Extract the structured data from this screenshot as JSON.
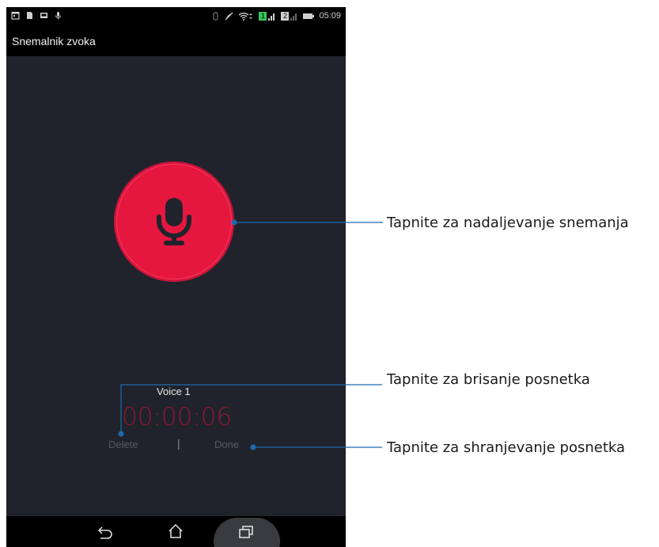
{
  "status_bar": {
    "time": "05:09",
    "sim1": "1",
    "sim2": "2",
    "left_icons": [
      "calendar-icon",
      "document-icon",
      "message-icon",
      "microphone-small-icon"
    ],
    "right_icons": [
      "bluetooth-icon",
      "mute-icon",
      "wifi-icon",
      "sim1-signal-icon",
      "sim2-signal-icon",
      "battery-icon"
    ]
  },
  "app": {
    "title": "Snemalnik zvoka"
  },
  "recording": {
    "name": "Voice 1",
    "elapsed": "00:00:06",
    "delete_label": "Delete",
    "separator": "|",
    "done_label": "Done"
  },
  "colors": {
    "accent": "#e5173f",
    "background": "#20232b",
    "timer": "#8f1a32",
    "callout_line": "#1e6ab0"
  },
  "annotations": {
    "resume": "Tapnite za nadaljevanje snemanja",
    "delete": "Tapnite za brisanje posnetka",
    "save": "Tapnite za shranjevanje posnetka"
  },
  "nav": {
    "back": "back-icon",
    "home": "home-icon",
    "recent": "recent-apps-icon"
  }
}
